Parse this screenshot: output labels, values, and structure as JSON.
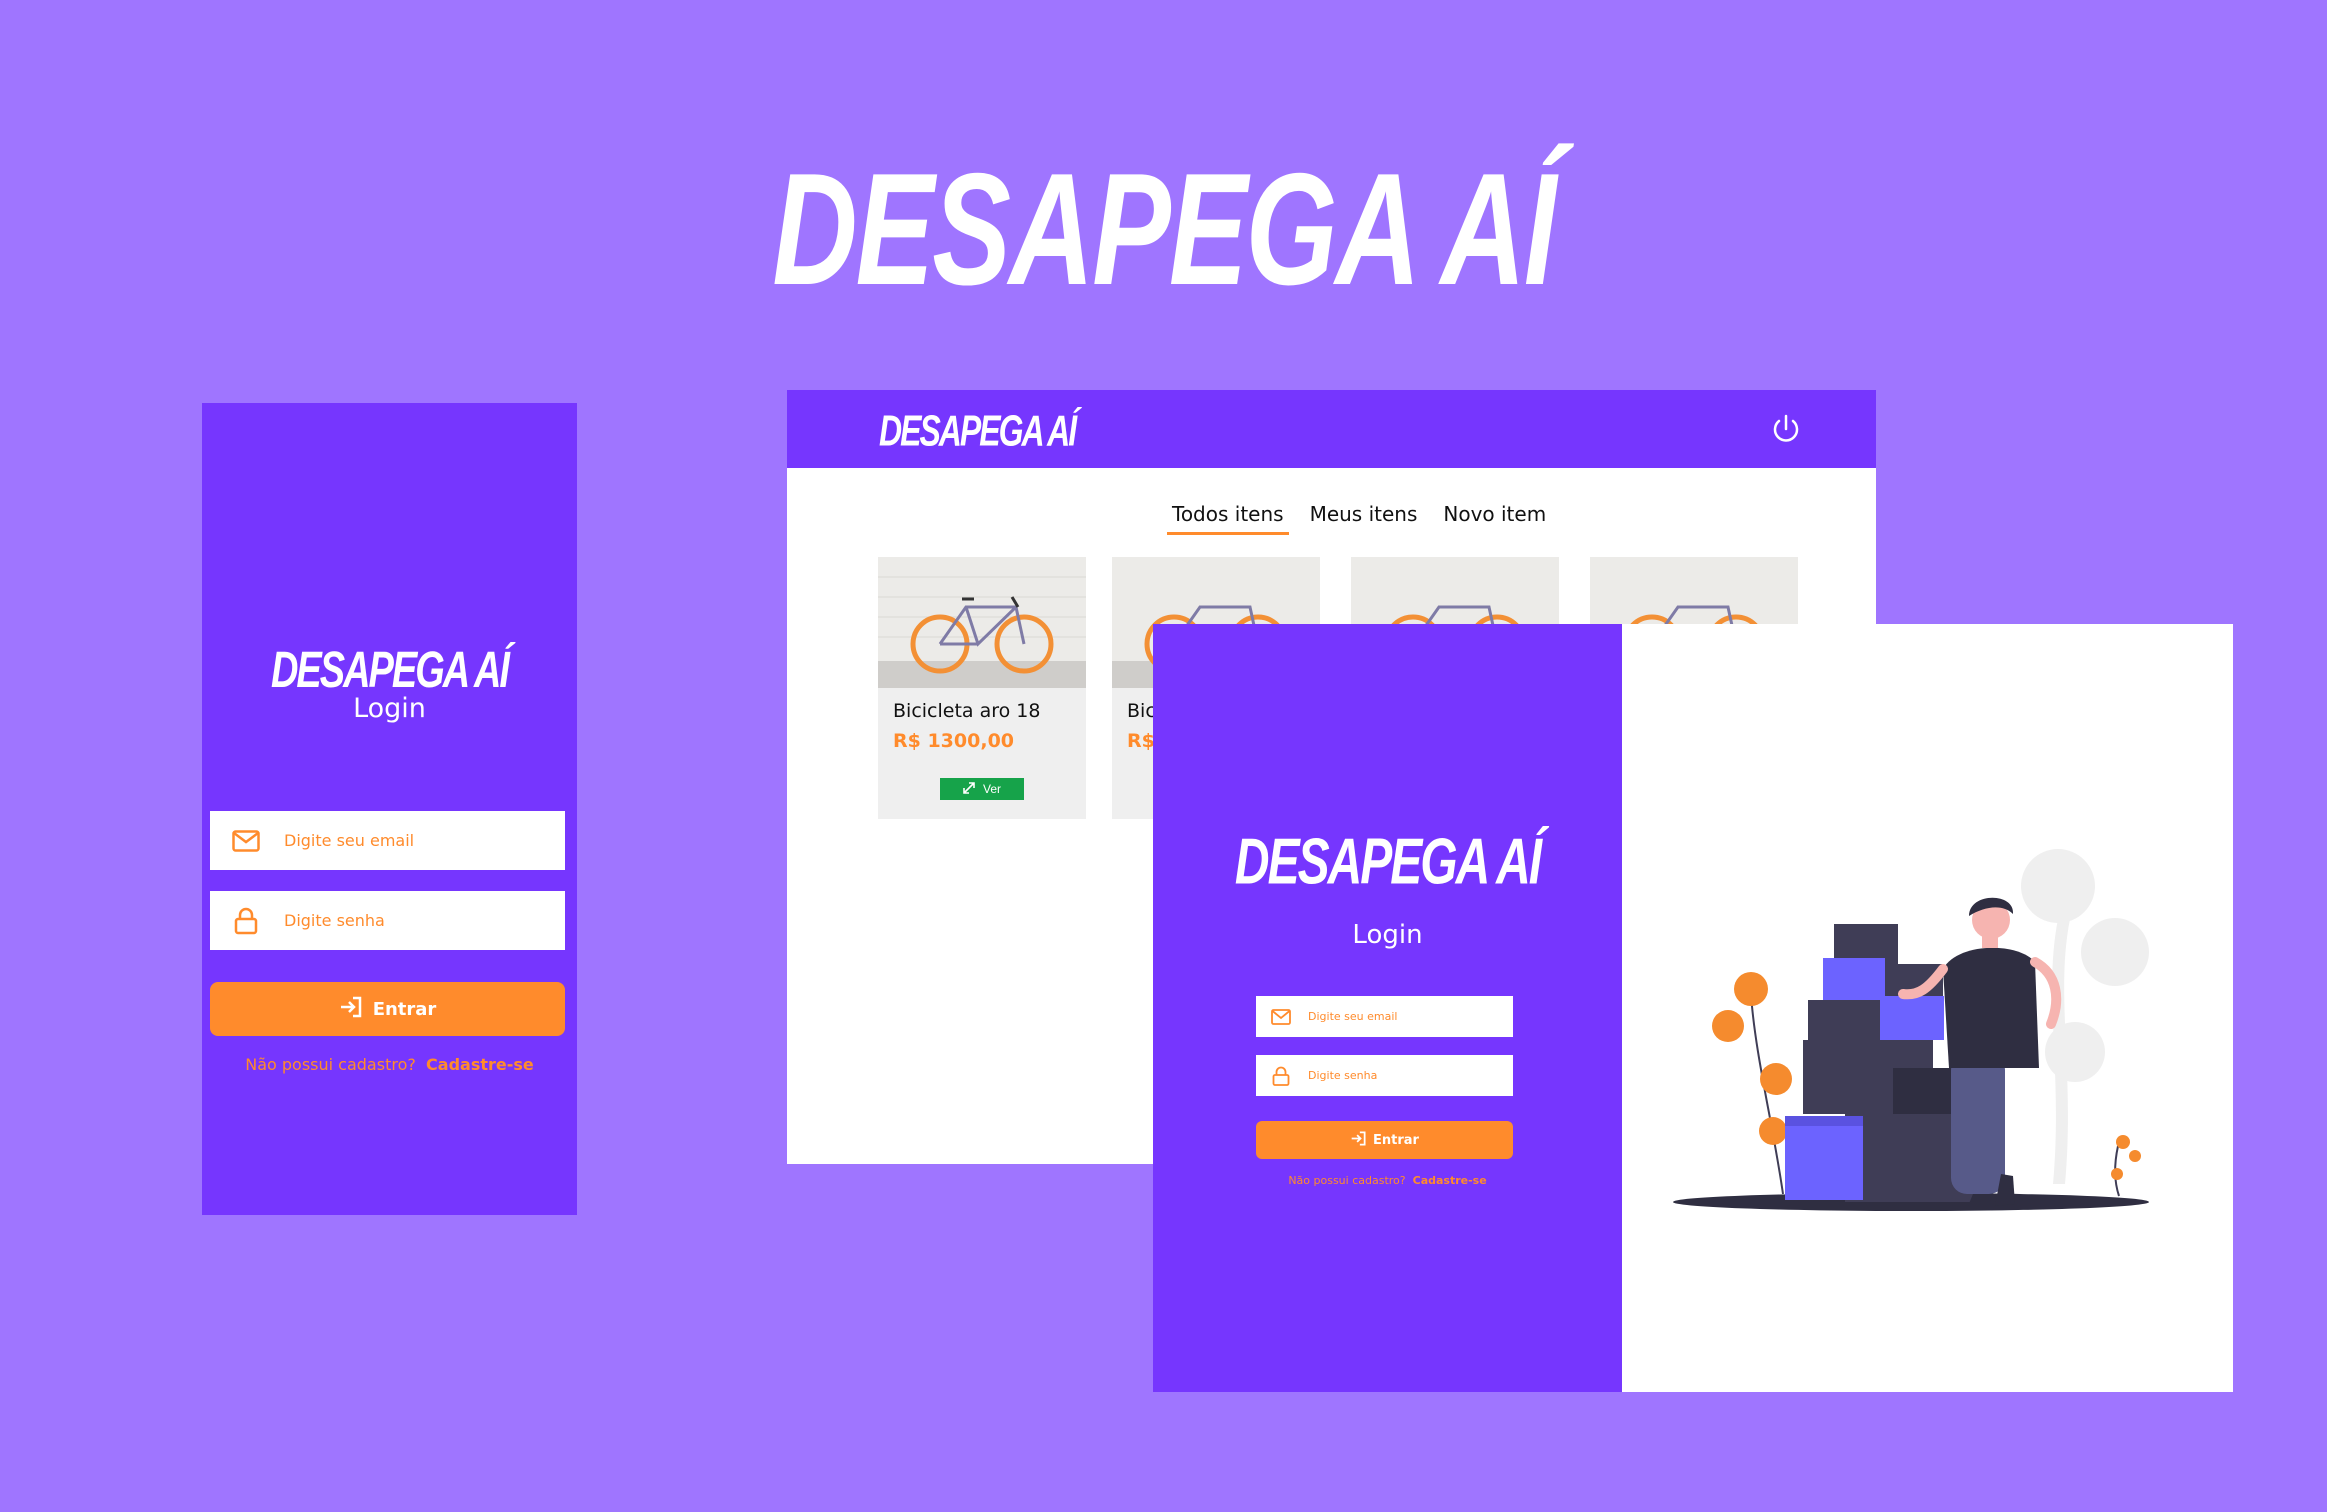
{
  "hero": {
    "title": "DESAPEGA AÍ"
  },
  "mobile": {
    "logo": "DESAPEGA AÍ",
    "title": "Login",
    "email_placeholder": "Digite seu email",
    "password_placeholder": "Digite senha",
    "submit_label": "Entrar",
    "signup_prompt": "Não possui cadastro?",
    "signup_link": "Cadastre-se"
  },
  "items_page": {
    "logo": "DESAPEGA AÍ",
    "tabs": [
      {
        "label": "Todos itens",
        "active": true
      },
      {
        "label": "Meus itens",
        "active": false
      },
      {
        "label": "Novo item",
        "active": false
      }
    ],
    "cards": [
      {
        "title": "Bicicleta aro 18",
        "price": "R$ 1300,00",
        "button": "Ver"
      },
      {
        "title": "Bic",
        "price": "R$"
      },
      {},
      {}
    ]
  },
  "desktop": {
    "logo": "DESAPEGA AÍ",
    "title": "Login",
    "email_placeholder": "Digite seu email",
    "password_placeholder": "Digite senha",
    "submit_label": "Entrar",
    "signup_prompt": "Não possui cadastro?",
    "signup_link": "Cadastre-se"
  },
  "colors": {
    "background": "#9f75ff",
    "brand_purple": "#7636fe",
    "accent_orange": "#ff8b2c",
    "view_green": "#16a34a"
  }
}
